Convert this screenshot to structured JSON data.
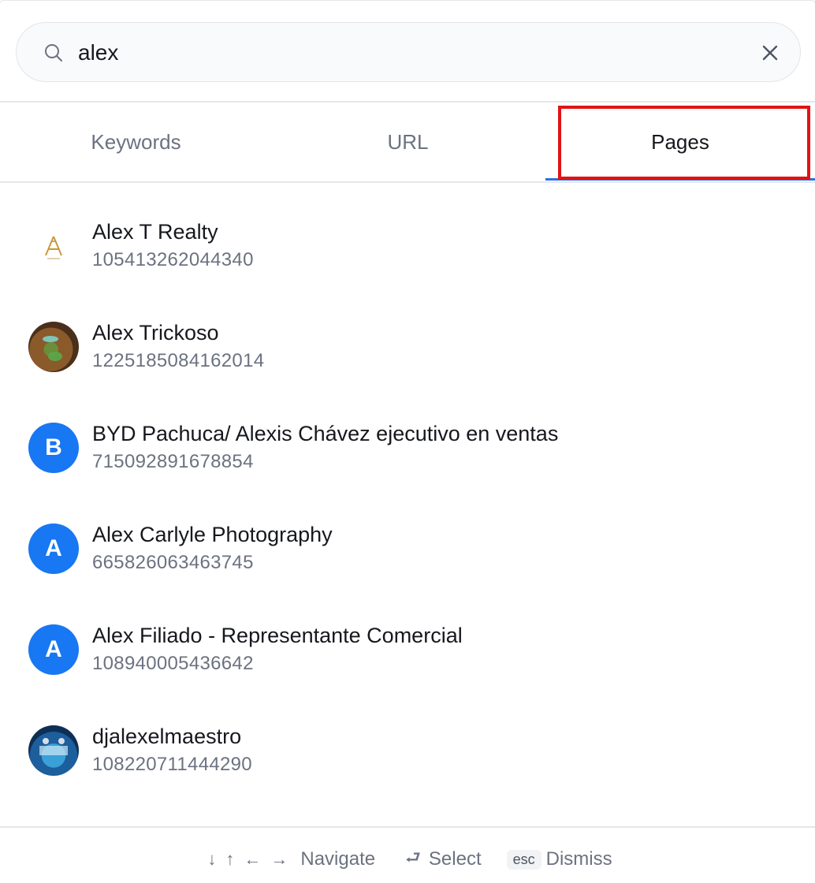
{
  "search": {
    "value": "alex",
    "clear_label": "×"
  },
  "tabs": [
    {
      "label": "Keywords",
      "active": false
    },
    {
      "label": "URL",
      "active": false
    },
    {
      "label": "Pages",
      "active": true
    }
  ],
  "results": [
    {
      "name": "Alex T Realty",
      "id": "105413262044340",
      "avatar": "logo-image"
    },
    {
      "name": "Alex Trickoso",
      "id": "1225185084162014",
      "avatar": "photo"
    },
    {
      "name": "BYD Pachuca/ Alexis Chávez ejecutivo en ventas",
      "id": "715092891678854",
      "avatar_letter": "B"
    },
    {
      "name": "Alex Carlyle Photography",
      "id": "665826063463745",
      "avatar_letter": "A"
    },
    {
      "name": "Alex Filiado - Representante Comercial",
      "id": "108940005436642",
      "avatar_letter": "A"
    },
    {
      "name": "djalexelmaestro",
      "id": "108220711444290",
      "avatar": "photo"
    }
  ],
  "footer": {
    "arrows": [
      "↓",
      "↑",
      "←",
      "→"
    ],
    "navigate_label": "Navigate",
    "select_icon": "⮐",
    "select_label": "Select",
    "esc_key": "esc",
    "dismiss_label": "Dismiss"
  },
  "colors": {
    "accent": "#2f6fde",
    "avatar_blue": "#1877f2",
    "highlight": "#e01414",
    "muted_text": "#6b7280"
  }
}
